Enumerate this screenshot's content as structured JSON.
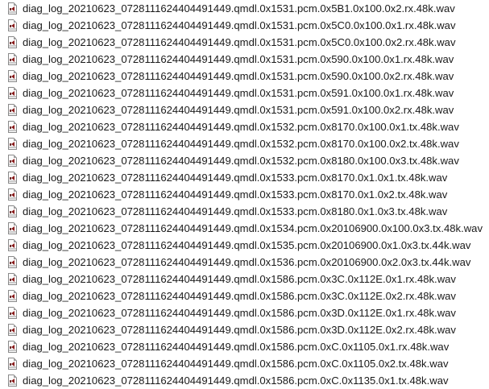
{
  "file_list": {
    "icon": "wav-audio-file-icon",
    "items": [
      {
        "name": "diag_log_20210623_0728111624404491449.qmdl.0x1531.pcm.0x5B1.0x100.0x2.rx.48k.wav"
      },
      {
        "name": "diag_log_20210623_0728111624404491449.qmdl.0x1531.pcm.0x5C0.0x100.0x1.rx.48k.wav"
      },
      {
        "name": "diag_log_20210623_0728111624404491449.qmdl.0x1531.pcm.0x5C0.0x100.0x2.rx.48k.wav"
      },
      {
        "name": "diag_log_20210623_0728111624404491449.qmdl.0x1531.pcm.0x590.0x100.0x1.rx.48k.wav"
      },
      {
        "name": "diag_log_20210623_0728111624404491449.qmdl.0x1531.pcm.0x590.0x100.0x2.rx.48k.wav"
      },
      {
        "name": "diag_log_20210623_0728111624404491449.qmdl.0x1531.pcm.0x591.0x100.0x1.rx.48k.wav"
      },
      {
        "name": "diag_log_20210623_0728111624404491449.qmdl.0x1531.pcm.0x591.0x100.0x2.rx.48k.wav"
      },
      {
        "name": "diag_log_20210623_0728111624404491449.qmdl.0x1532.pcm.0x8170.0x100.0x1.tx.48k.wav"
      },
      {
        "name": "diag_log_20210623_0728111624404491449.qmdl.0x1532.pcm.0x8170.0x100.0x2.tx.48k.wav"
      },
      {
        "name": "diag_log_20210623_0728111624404491449.qmdl.0x1532.pcm.0x8180.0x100.0x3.tx.48k.wav"
      },
      {
        "name": "diag_log_20210623_0728111624404491449.qmdl.0x1533.pcm.0x8170.0x1.0x1.tx.48k.wav"
      },
      {
        "name": "diag_log_20210623_0728111624404491449.qmdl.0x1533.pcm.0x8170.0x1.0x2.tx.48k.wav"
      },
      {
        "name": "diag_log_20210623_0728111624404491449.qmdl.0x1533.pcm.0x8180.0x1.0x3.tx.48k.wav"
      },
      {
        "name": "diag_log_20210623_0728111624404491449.qmdl.0x1534.pcm.0x20106900.0x100.0x3.tx.48k.wav"
      },
      {
        "name": "diag_log_20210623_0728111624404491449.qmdl.0x1535.pcm.0x20106900.0x1.0x3.tx.44k.wav"
      },
      {
        "name": "diag_log_20210623_0728111624404491449.qmdl.0x1536.pcm.0x20106900.0x2.0x3.tx.44k.wav"
      },
      {
        "name": "diag_log_20210623_0728111624404491449.qmdl.0x1586.pcm.0x3C.0x112E.0x1.rx.48k.wav"
      },
      {
        "name": "diag_log_20210623_0728111624404491449.qmdl.0x1586.pcm.0x3C.0x112E.0x2.rx.48k.wav"
      },
      {
        "name": "diag_log_20210623_0728111624404491449.qmdl.0x1586.pcm.0x3D.0x112E.0x1.rx.48k.wav"
      },
      {
        "name": "diag_log_20210623_0728111624404491449.qmdl.0x1586.pcm.0x3D.0x112E.0x2.rx.48k.wav"
      },
      {
        "name": "diag_log_20210623_0728111624404491449.qmdl.0x1586.pcm.0xC.0x1105.0x1.rx.48k.wav"
      },
      {
        "name": "diag_log_20210623_0728111624404491449.qmdl.0x1586.pcm.0xC.0x1105.0x2.tx.48k.wav"
      },
      {
        "name": "diag_log_20210623_0728111624404491449.qmdl.0x1586.pcm.0xC.0x1135.0x1.tx.48k.wav"
      }
    ]
  }
}
